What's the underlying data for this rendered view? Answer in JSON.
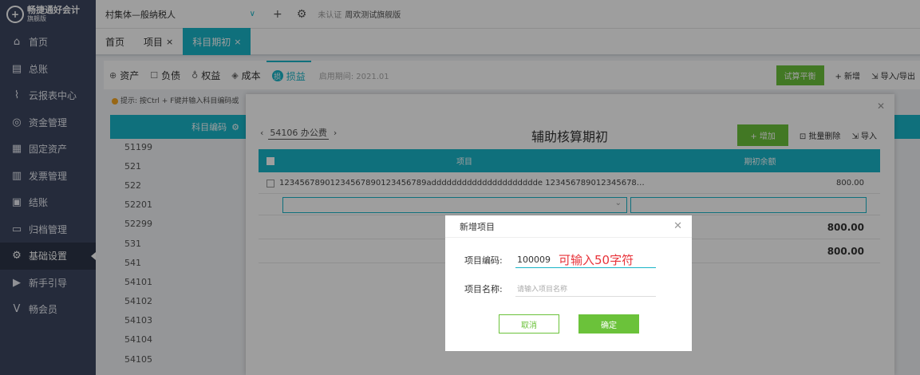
{
  "brand": {
    "name": "畅捷通好会计",
    "edition": "旗舰版"
  },
  "sidebar": {
    "items": [
      {
        "label": "首页",
        "icon": "home-icon",
        "glyph": "⌂"
      },
      {
        "label": "总账",
        "icon": "ledger-icon",
        "glyph": "▤"
      },
      {
        "label": "云报表中心",
        "icon": "chart-icon",
        "glyph": "⌇"
      },
      {
        "label": "资金管理",
        "icon": "money-icon",
        "glyph": "◎"
      },
      {
        "label": "固定资产",
        "icon": "asset-icon",
        "glyph": "▦"
      },
      {
        "label": "发票管理",
        "icon": "invoice-icon",
        "glyph": "▥"
      },
      {
        "label": "结账",
        "icon": "close-book-icon",
        "glyph": "▣"
      },
      {
        "label": "归档管理",
        "icon": "archive-icon",
        "glyph": "▭"
      },
      {
        "label": "基础设置",
        "icon": "settings-icon",
        "glyph": "⚙",
        "active": true
      },
      {
        "label": "新手引导",
        "icon": "guide-icon",
        "glyph": "▶"
      },
      {
        "label": "畅会员",
        "icon": "vip-icon",
        "glyph": "V"
      }
    ]
  },
  "topbar": {
    "org": "村集体—般纳税人",
    "plus": "+",
    "gear": "⚙",
    "auth_status": "未认证",
    "auth_name": "周欢测试旗舰版"
  },
  "tabs": [
    {
      "label": "首页",
      "closable": false
    },
    {
      "label": "项目",
      "closable": true
    },
    {
      "label": "科目期初",
      "closable": true,
      "active": true
    }
  ],
  "toolbar": {
    "categories": [
      "资产",
      "负债",
      "权益",
      "成本",
      "损益"
    ],
    "category_icons": [
      "⊕",
      "☐",
      "♁",
      "◈",
      "损"
    ],
    "active_category": "损益",
    "period": "启用期间: 2021.01",
    "trial_balance": "试算平衡",
    "add": "+ 新增",
    "import_export": "导入/导出"
  },
  "tip": "提示: 按Ctrl + F键并输入科目编码或",
  "code_column": {
    "header": "科目编码",
    "codes": [
      "51199",
      "521",
      "522",
      "52201",
      "52299",
      "531",
      "541",
      "54101",
      "54102",
      "54103",
      "54104",
      "54105"
    ]
  },
  "aux_dialog": {
    "title": "辅助核算期初",
    "account": "54106 办公费",
    "add": "+ 增加",
    "batch_delete": "批量删除",
    "import": "导入",
    "columns": [
      "项目",
      "期初余额"
    ],
    "rows": [
      {
        "item": "12345678901234567890123456789addddddddddddddddddddde 1234567890123456789012345...",
        "amount": "800.00"
      }
    ],
    "totals": [
      "800.00",
      "800.00"
    ]
  },
  "new_item_modal": {
    "title": "新增项目",
    "code_label": "项目编码:",
    "code_value": "100009",
    "code_hint": "可输入50字符",
    "name_label": "项目名称:",
    "name_placeholder": "请输入项目名称",
    "cancel": "取消",
    "confirm": "确定"
  }
}
